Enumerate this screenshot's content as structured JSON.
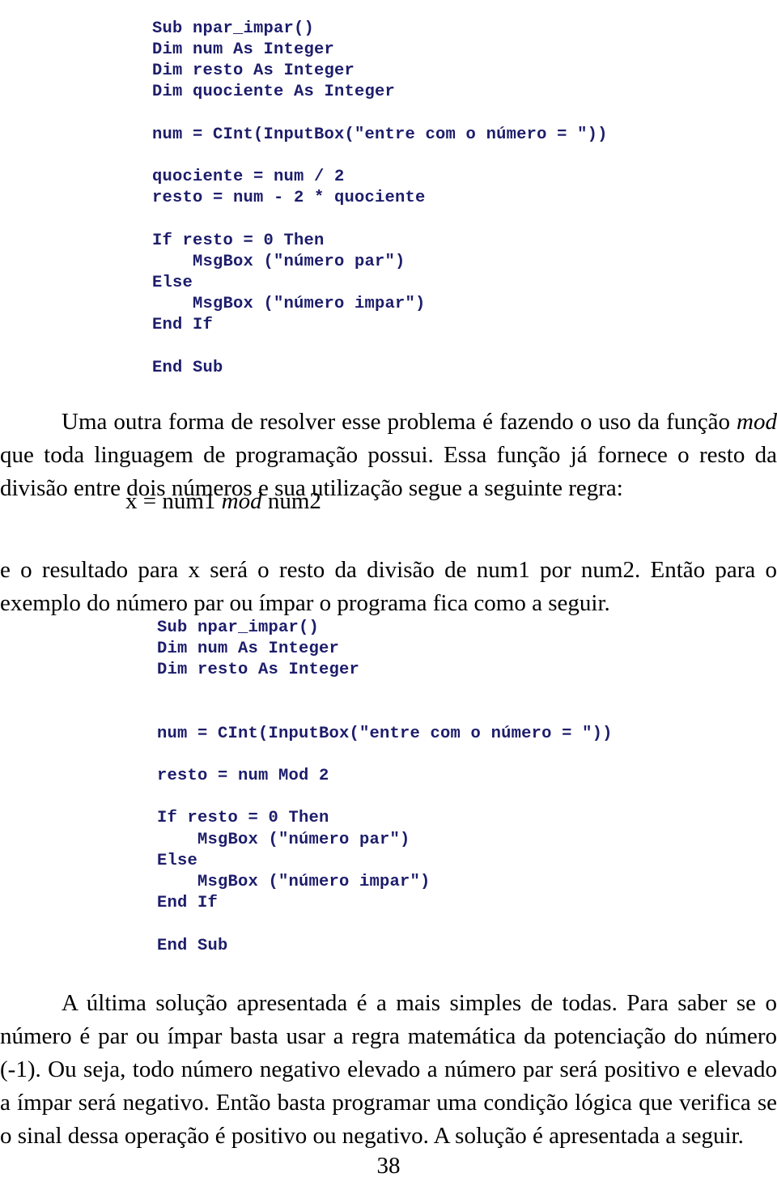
{
  "document": {
    "page_number": "38",
    "code_color": "#1d1d6b",
    "text_color": "#000000",
    "background": "#ffffff"
  },
  "code_block_1": {
    "name": "vba-code-listing-quociente",
    "lines": [
      "Sub npar_impar()",
      "Dim num As Integer",
      "Dim resto As Integer",
      "Dim quociente As Integer",
      "",
      "num = CInt(InputBox(\"entre com o número = \"))",
      "",
      "quociente = num / 2",
      "resto = num - 2 * quociente",
      "",
      "If resto = 0 Then",
      "    MsgBox (\"número par\")",
      "Else",
      "    MsgBox (\"número impar\")",
      "End If",
      "",
      "End Sub"
    ]
  },
  "code_block_2": {
    "name": "vba-code-listing-mod",
    "lines": [
      "Sub npar_impar()",
      "Dim num As Integer",
      "Dim resto As Integer",
      "",
      "",
      "num = CInt(InputBox(\"entre com o número = \"))",
      "",
      "resto = num Mod 2",
      "",
      "If resto = 0 Then",
      "    MsgBox (\"número par\")",
      "Else",
      "    MsgBox (\"número impar\")",
      "End If",
      "",
      "End Sub"
    ]
  },
  "paragraphs": {
    "mod_intro_part1": "Uma outra forma de resolver esse problema é fazendo o uso da função ",
    "mod_intro_italic": "mod",
    "mod_intro_part2": " que toda linguagem de programação possui. Essa função já fornece o resto da divisão entre dois números e sua utilização segue a seguinte regra:",
    "formula_prefix": "x = num1 ",
    "formula_italic": "mod",
    "formula_suffix": " num2",
    "resultado": "e o resultado para x será o resto da divisão de num1 por num2. Então para o exemplo do número par ou ímpar o programa fica como a seguir.",
    "final": "A última solução apresentada é a mais simples de todas. Para saber se o número é par ou ímpar basta usar a regra matemática da potenciação do número (-1). Ou seja, todo número negativo elevado a número par será positivo e elevado a ímpar será negativo. Então basta programar uma condição lógica que verifica se o sinal dessa operação é positivo ou negativo. A solução é apresentada a seguir."
  }
}
